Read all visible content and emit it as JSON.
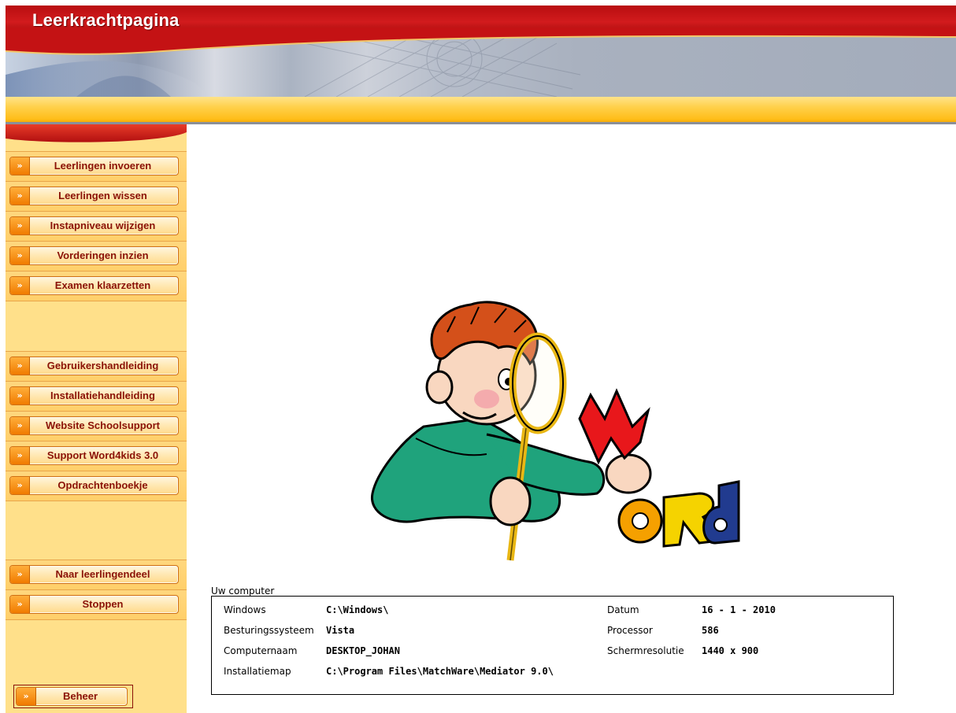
{
  "header": {
    "title": "Leerkrachtpagina"
  },
  "menu": {
    "group1": [
      {
        "label": "Leerlingen invoeren"
      },
      {
        "label": "Leerlingen wissen"
      },
      {
        "label": "Instapniveau wijzigen"
      },
      {
        "label": "Vorderingen inzien"
      },
      {
        "label": "Examen klaarzetten"
      }
    ],
    "group2": [
      {
        "label": "Gebruikershandleiding"
      },
      {
        "label": "Installatiehandleiding"
      },
      {
        "label": "Website Schoolsupport"
      },
      {
        "label": "Support Word4kids 3.0"
      },
      {
        "label": "Opdrachtenboekje"
      }
    ],
    "group3": [
      {
        "label": "Naar leerlingendeel"
      },
      {
        "label": "Stoppen"
      }
    ],
    "admin": {
      "label": "Beheer"
    },
    "arrow_glyph": "»"
  },
  "illustration": {
    "word": "WORD"
  },
  "computer_info": {
    "legend": "Uw computer",
    "left": [
      {
        "label": "Windows",
        "value": "C:\\Windows\\"
      },
      {
        "label": "Besturingssysteem",
        "value": "Vista"
      },
      {
        "label": "Computernaam",
        "value": "DESKTOP_JOHAN"
      },
      {
        "label": "Installatiemap",
        "value": "C:\\Program Files\\MatchWare\\Mediator 9.0\\"
      }
    ],
    "right": [
      {
        "label": "Datum",
        "value": "16 - 1 - 2010"
      },
      {
        "label": "Processor",
        "value": "586"
      },
      {
        "label": "Schermresolutie",
        "value": "1440 x 900"
      }
    ]
  },
  "colors": {
    "header_red": "#c41214",
    "header_orange": "#ffc61f",
    "sidebar_bg": "#ffe08a",
    "button_text": "#8a1207",
    "arrow_orange": "#f58a00"
  }
}
